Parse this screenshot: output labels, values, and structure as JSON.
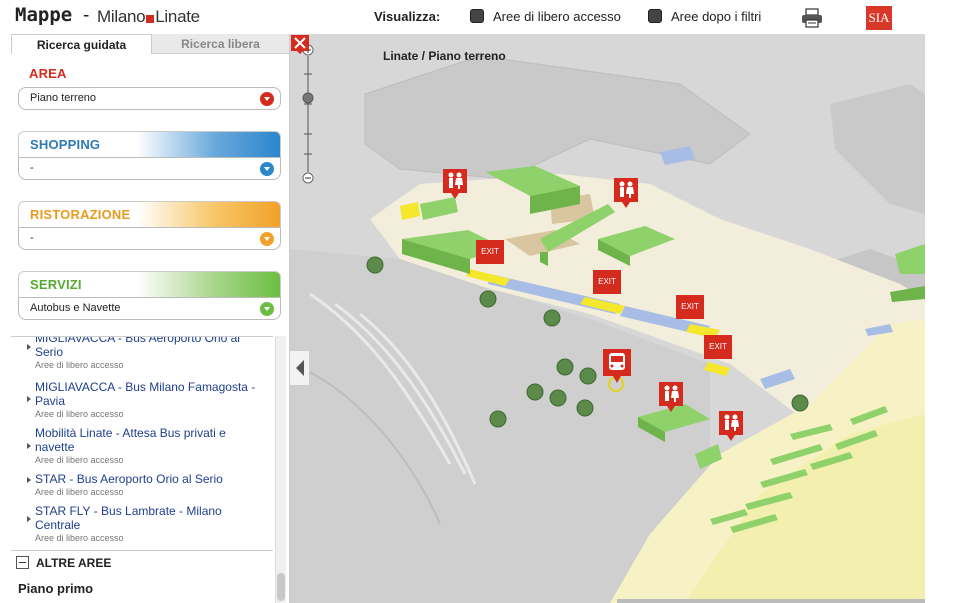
{
  "header": {
    "title_main": "Mappe",
    "title_dash": "-",
    "title_airport_a": "Milano",
    "title_airport_b": "Linate",
    "visualizza_label": "Visualizza:",
    "option1_label": "Aree di libero accesso",
    "option2_label": "Aree dopo i filtri",
    "logo_text": "SIA",
    "print_icon": "printer-icon"
  },
  "sidebar": {
    "tabs": [
      {
        "label": "Ricerca guidata",
        "active": true
      },
      {
        "label": "Ricerca libera",
        "active": false
      }
    ],
    "area": {
      "title": "AREA",
      "value": "Piano terreno",
      "color": "#d52b1e"
    },
    "shopping": {
      "title": "SHOPPING",
      "value": "-",
      "color": "#2b86cc"
    },
    "ristorazione": {
      "title": "RISTORAZIONE",
      "value": "-",
      "color": "#f0a22a"
    },
    "servizi": {
      "title": "SERVIZI",
      "value": "Autobus e Navette",
      "color": "#6cbe43"
    },
    "results": [
      {
        "name": "MIGLIAVACCA - Bus Aeroporto Orio al Serio",
        "sub": "Aree di libero accesso"
      },
      {
        "name": "MIGLIAVACCA - Bus Milano Famagosta - Pavia",
        "sub": "Aree di libero accesso"
      },
      {
        "name": "Mobilità Linate - Attesa Bus privati e navette",
        "sub": "Aree di libero accesso"
      },
      {
        "name": "STAR - Bus Aeroporto Orio al Serio",
        "sub": "Aree di libero accesso"
      },
      {
        "name": "STAR FLY - Bus Lambrate - Milano Centrale",
        "sub": "Aree di libero accesso"
      }
    ],
    "altre_aree_label": "ALTRE AREE",
    "piano_primo_label": "Piano primo"
  },
  "map": {
    "title": "Linate / Piano terreno",
    "exit_label": "EXIT",
    "colors": {
      "background": "#d9d9d9",
      "floor": "#f3eedb",
      "green_block": "#8fd16b",
      "yellow": "#f4e72c",
      "blue": "#a7bde6",
      "pin_red": "#d52b1e",
      "tree": "#5b8a4a"
    }
  }
}
